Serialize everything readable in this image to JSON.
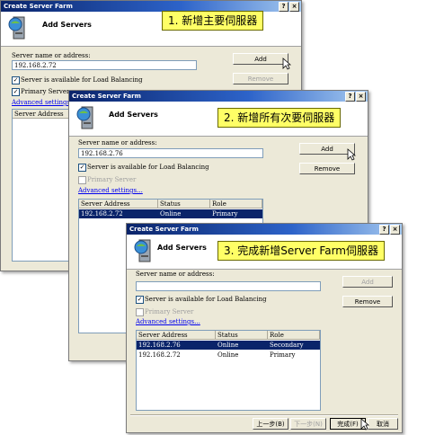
{
  "window_title": "Create Server Farm",
  "header_title": "Add Servers",
  "server_name_label": "Server name or address:",
  "lb_checkbox_label": "Server is available for Load Balancing",
  "primary_checkbox_label": "Primary Server",
  "advanced_link": "Advanced settings...",
  "add_button": "Add",
  "remove_button": "Remove",
  "columns": [
    "Server Address",
    "Status",
    "Role"
  ],
  "callouts": [
    "1. 新增主要伺服器",
    "2. 新增所有次要伺服器",
    "3. 完成新增Server Farm伺服器"
  ],
  "dialog1": {
    "server_input": "192.168.2.72",
    "columns": [
      "Server Address"
    ]
  },
  "dialog2": {
    "server_input": "192.168.2.76",
    "rows": [
      {
        "address": "192.168.2.72",
        "status": "Online",
        "role": "Primary"
      }
    ]
  },
  "dialog3": {
    "server_input": "",
    "rows": [
      {
        "address": "192.168.2.76",
        "status": "Online",
        "role": "Secondary"
      },
      {
        "address": "192.168.2.72",
        "status": "Online",
        "role": "Primary"
      }
    ],
    "back_button": "上一步(B)",
    "next_button": "下一步(N)",
    "finish_button": "完成(F)",
    "cancel_button": "取消"
  }
}
